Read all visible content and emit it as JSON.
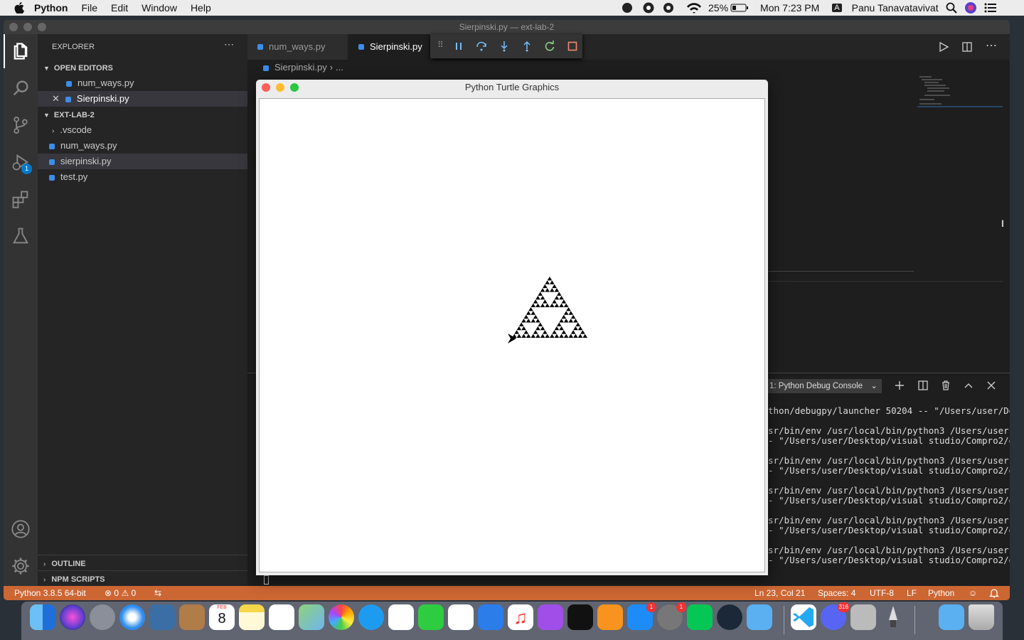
{
  "menubar": {
    "app": "Python",
    "items": [
      "File",
      "Edit",
      "Window",
      "Help"
    ],
    "battery": "25%",
    "clock": "Mon 7:23 PM",
    "input_source": "A",
    "user": "Panu Tanavatavivat"
  },
  "window": {
    "title": "Sierpinski.py — ext-lab-2"
  },
  "sidebar": {
    "header": "EXPLORER",
    "open_editors": "OPEN EDITORS",
    "open_files": [
      "num_ways.py",
      "Sierpinski.py"
    ],
    "folder": "EXT-LAB-2",
    "items": [
      ".vscode",
      "num_ways.py",
      "sierpinski.py",
      "test.py"
    ],
    "outline": "OUTLINE",
    "npm": "NPM SCRIPTS"
  },
  "tabs": [
    "num_ways.py",
    "Sierpinski.py"
  ],
  "breadcrumb": {
    "file": "Sierpinski.py",
    "rest": "..."
  },
  "activity": {
    "debug_badge": "1"
  },
  "turtle": {
    "title": "Python Turtle Graphics"
  },
  "panel": {
    "dropdown": "1: Python Debug Console",
    "lines": [
      "thon/debugpy/launcher 50204 -- \"/Users/user/De",
      "sr/bin/env /usr/local/bin/python3 /Users/user",
      "- \"/Users/user/Desktop/visual studio/Compro2/e",
      "sr/bin/env /usr/local/bin/python3 /Users/user",
      "- \"/Users/user/Desktop/visual studio/Compro2/e",
      "sr/bin/env /usr/local/bin/python3 /Users/user",
      "- \"/Users/user/Desktop/visual studio/Compro2/e",
      "sr/bin/env /usr/local/bin/python3 /Users/user",
      "- \"/Users/user/Desktop/visual studio/Compro2/e",
      "sr/bin/env /usr/local/bin/python3 /Users/user",
      "- \"/Users/user/Desktop/visual studio/Compro2/e"
    ]
  },
  "status": {
    "python": "Python 3.8.5 64-bit",
    "errors": "0",
    "warnings": "0",
    "position": "Ln 23, Col 21",
    "spaces": "Spaces: 4",
    "encoding": "UTF-8",
    "eol": "LF",
    "lang": "Python"
  },
  "dock": {
    "calendar_month": "FEB",
    "calendar_day": "8",
    "badge_appstore": "1",
    "badge_prefs": "1",
    "badge_discord": "316"
  },
  "colors": {
    "status": "#cc6633",
    "accent": "#007acc"
  }
}
